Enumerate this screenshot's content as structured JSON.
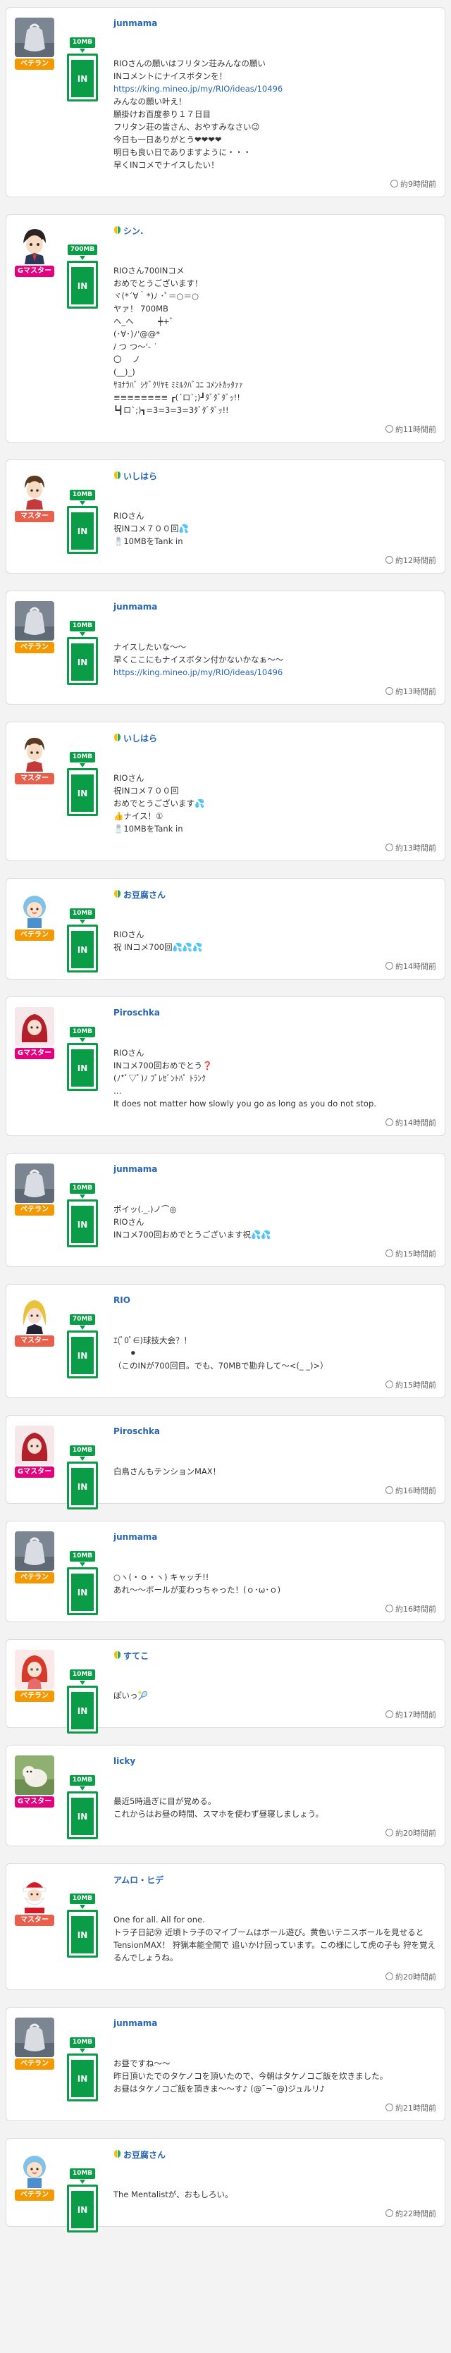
{
  "posts": [
    {
      "user": "junmama",
      "badge": false,
      "rank": "ベテラン",
      "rank_color": "#f39800",
      "tank": "10MB",
      "avatar": "gray-bag",
      "lines": [
        "RIOさんの願いはフリタン荘みんなの願い",
        "INコメントにナイスボタンを！"
      ],
      "link": "https://king.mineo.jp/my/RIO/ideas/10496",
      "lines2": [
        "みんなの願い叶え！",
        "願掛けお百度参り１７日目",
        "フリタン荘の皆さん、おやすみなさい😉",
        "今日も一日ありがとう❤❤❤❤",
        "明日も良い日でありますように・・・",
        "早くINコメでナイスしたい！"
      ],
      "time": "約9時間前"
    },
    {
      "user": "シン.",
      "badge": true,
      "rank": "Gマスター",
      "rank_color": "#e4007f",
      "tank": "700MB",
      "avatar": "anime-boy",
      "lines": [
        "RIOさん700INコメ",
        "おめでとうございます！",
        "ヾ(*´∀｀*)ﾉ ･ﾟ＝○＝○",
        "ヤァ！ 700MB",
        "ヘ_ヘ　　　┿+゜",
        "(･∀･)ﾉ'@@*",
        "/ つ つ〜'- ˙",
        "〇　 ノ",
        "(__)_)",
        "ｻﾖﾅﾗﾊﾞ ｼｹﾞｸﾘﾔﾓ ﾐﾐﾙｸﾊﾞｺﾆ ｺﾒﾝﾄｶｯﾀｧｧ",
        "≡≡≡≡≡≡≡≡ ┏(´ロ`;)┛ﾀﾞﾀﾞﾀﾞｯ!!",
        "┗┫ロ`;)┓=3=3=3=3ﾀﾞﾀﾞﾀﾞｯ!!"
      ],
      "link": "",
      "lines2": [],
      "time": "約11時間前"
    },
    {
      "user": "いしはら",
      "badge": true,
      "rank": "マスター",
      "rank_color": "#e8604c",
      "tank": "10MB",
      "avatar": "anime-boy2",
      "lines": [
        "RIOさん",
        "祝INコメ７００回💦",
        "🧂10MBをTank in"
      ],
      "link": "",
      "lines2": [],
      "time": "約12時間前"
    },
    {
      "user": "junmama",
      "badge": false,
      "rank": "ベテラン",
      "rank_color": "#f39800",
      "tank": "10MB",
      "avatar": "gray-bag",
      "lines": [
        "ナイスしたいな〜〜",
        "早くここにもナイスボタン付かないかなぁ〜〜"
      ],
      "link": "https://king.mineo.jp/my/RIO/ideas/10496",
      "lines2": [],
      "time": "約13時間前"
    },
    {
      "user": "いしはら",
      "badge": true,
      "rank": "マスター",
      "rank_color": "#e8604c",
      "tank": "10MB",
      "avatar": "anime-boy2",
      "lines": [
        "RIOさん",
        "祝INコメ７００回",
        "おめでとうございます💦",
        "👍ナイス！①",
        "🧂10MBをTank in"
      ],
      "link": "",
      "lines2": [],
      "time": "約13時間前"
    },
    {
      "user": "お豆腐さん",
      "badge": true,
      "rank": "ベテラン",
      "rank_color": "#f39800",
      "tank": "10MB",
      "avatar": "cartoon-kid",
      "lines": [
        "RIOさん",
        "祝 INコメ700回💦💦💦"
      ],
      "link": "",
      "lines2": [],
      "time": "約14時間前"
    },
    {
      "user": "Piroschka",
      "badge": false,
      "rank": "Gマスター",
      "rank_color": "#e4007f",
      "tank": "10MB",
      "avatar": "red-hair",
      "lines": [
        "RIOさん",
        "INコメ700回おめでとう❓",
        "(ﾉ*ﾟ▽ﾟ)ﾉ ﾌﾟﾚｾﾞﾝﾄﾊﾟ ﾄﾗﾝｸ",
        "…",
        "It does not matter how slowly you go as long as you do not stop."
      ],
      "link": "",
      "lines2": [],
      "time": "約14時間前"
    },
    {
      "user": "junmama",
      "badge": false,
      "rank": "ベテラン",
      "rank_color": "#f39800",
      "tank": "10MB",
      "avatar": "gray-bag",
      "lines": [
        "ポイッ(._.)ノ⌒◎",
        "RIOさん",
        "INコメ700回おめでとうございます祝💦💦"
      ],
      "link": "",
      "lines2": [],
      "time": "約15時間前"
    },
    {
      "user": "RIO",
      "badge": false,
      "rank": "マスター",
      "rank_color": "#e8604c",
      "tank": "70MB",
      "avatar": "blonde",
      "lines": [
        "ｴ(ﾟ0ﾟ∈)球技大会？！",
        "　　⚫",
        "（このINが700回目。でも、70MBで勘弁して〜<(_ _)>）"
      ],
      "link": "",
      "lines2": [],
      "time": "約15時間前"
    },
    {
      "user": "Piroschka",
      "badge": false,
      "rank": "Gマスター",
      "rank_color": "#e4007f",
      "tank": "10MB",
      "avatar": "red-hair",
      "lines": [
        "白鳥さんもテンションMAX！"
      ],
      "link": "",
      "lines2": [],
      "time": "約16時間前"
    },
    {
      "user": "junmama",
      "badge": false,
      "rank": "ベテラン",
      "rank_color": "#f39800",
      "tank": "10MB",
      "avatar": "gray-bag",
      "lines": [
        "○ヽ(・ｏ・ヽ) キャッチ!!",
        "あれ〜〜ボールが変わっちゃった！(ｏ･ω･ｏ)"
      ],
      "link": "",
      "lines2": [],
      "time": "約16時間前"
    },
    {
      "user": "すてこ",
      "badge": true,
      "rank": "ベテラン",
      "rank_color": "#f39800",
      "tank": "10MB",
      "avatar": "red-girl",
      "lines": [
        "ぽいっ🎾"
      ],
      "link": "",
      "lines2": [],
      "time": "約17時間前"
    },
    {
      "user": "licky",
      "badge": false,
      "rank": "Gマスター",
      "rank_color": "#e4007f",
      "tank": "10MB",
      "avatar": "dog",
      "lines": [
        "最近5時過ぎに目が覚める。",
        "これからはお昼の時間、スマホを使わず昼寝しましょう。"
      ],
      "link": "",
      "lines2": [],
      "time": "約20時間前"
    },
    {
      "user": "アムロ・ヒデ",
      "badge": false,
      "rank": "マスター",
      "rank_color": "#e8604c",
      "tank": "10MB",
      "avatar": "santa",
      "lines": [
        "One for all. All for one.",
        "トラ子日記㊿ 近頃トラ子のマイブームはボール遊び。黄色いテニスボールを見せるとTensionMAX！ 狩猟本能全開で 追いかけ回っています。この様にして虎の子も 狩を覚えるんでしょうね。"
      ],
      "link": "",
      "lines2": [],
      "time": "約20時間前"
    },
    {
      "user": "junmama",
      "badge": false,
      "rank": "ベテラン",
      "rank_color": "#f39800",
      "tank": "10MB",
      "avatar": "gray-bag",
      "lines": [
        "お昼ですね〜〜",
        "昨日頂いたでのタケノコを頂いたので、今朝はタケノコご飯を炊きました。",
        "お昼はタケノコご飯を頂きま〜〜す♪ (@¯¬¯@)ジュルリ♪"
      ],
      "link": "",
      "lines2": [],
      "time": "約21時間前"
    },
    {
      "user": "お豆腐さん",
      "badge": true,
      "rank": "ベテラン",
      "rank_color": "#f39800",
      "tank": "10MB",
      "avatar": "cartoon-kid",
      "lines": [
        "The Mentalistが、おもしろい。"
      ],
      "link": "",
      "lines2": [],
      "time": "約22時間前"
    }
  ],
  "tank_in_label": "IN"
}
